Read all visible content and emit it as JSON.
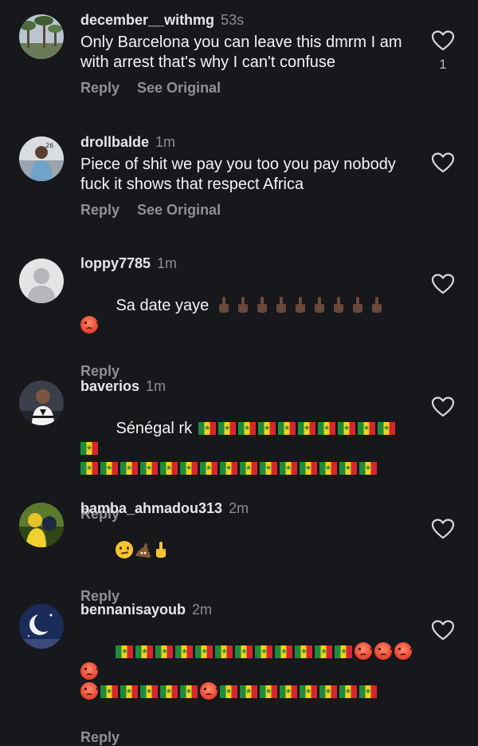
{
  "comments": [
    {
      "username": "december__withmg",
      "time": "53s",
      "text": "Only Barcelona you can leave this dmrm I am with arrest that's why I can't confuse",
      "reply": "Reply",
      "see_original": "See Original",
      "likes": "1"
    },
    {
      "username": "drollbalde",
      "time": "1m",
      "text": "Piece of shit we pay you too you pay nobody fuck it shows that respect Africa",
      "reply": "Reply",
      "see_original": "See Original",
      "likes": ""
    },
    {
      "username": "loppy7785",
      "time": "1m",
      "text": "Sa date yaye",
      "reply": "Reply",
      "likes": ""
    },
    {
      "username": "baverios",
      "time": "1m",
      "text": "Sénégal rk",
      "reply": "Reply",
      "likes": ""
    },
    {
      "username": "bamba_ahmadou313",
      "time": "2m",
      "text": "",
      "reply": "Reply",
      "likes": ""
    },
    {
      "username": "bennanisayoub",
      "time": "2m",
      "text": "",
      "reply": "Reply",
      "likes": ""
    }
  ],
  "icons": {
    "like": "heart-outline-icon",
    "flag": "senegal-flag-emoji",
    "angry": "angry-face-emoji",
    "middle_finger": "middle-finger-emoji",
    "confused": "confused-face-emoji",
    "poop": "pile-of-poo-emoji"
  },
  "colors": {
    "background": "#17181c",
    "username": "#e6e6e8",
    "meta": "#8c8d92",
    "text": "#f4f4f5",
    "action": "#8f9095"
  }
}
